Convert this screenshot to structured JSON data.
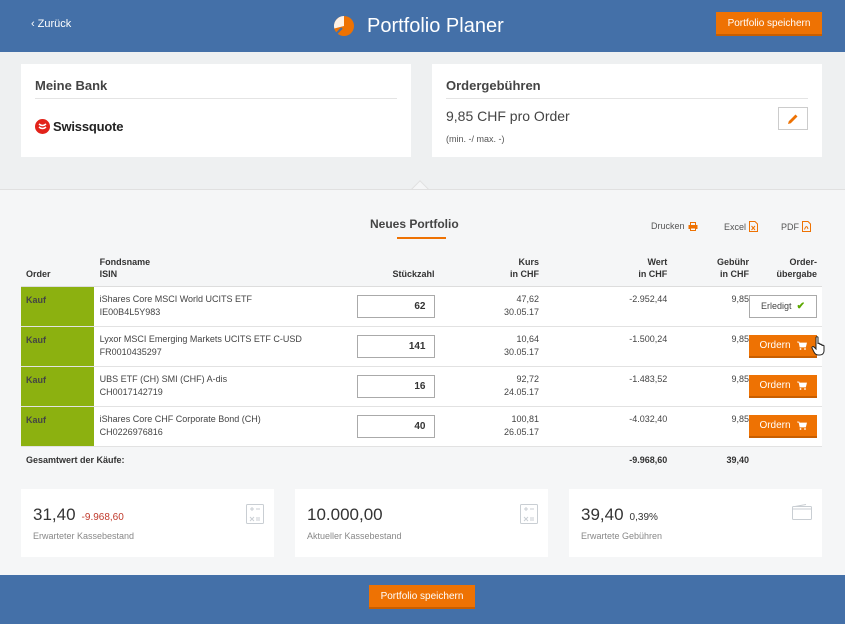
{
  "header": {
    "back_label": "Zurück",
    "title": "Portfolio Planer",
    "save_label": "Portfolio speichern",
    "logo_icon": "pie-chart-logo-icon"
  },
  "bank": {
    "heading": "Meine Bank",
    "name": "Swissquote"
  },
  "fees": {
    "heading": "Ordergebühren",
    "per_order": "9,85 CHF pro Order",
    "minmax": "(min. -/ max. -)",
    "edit_icon": "pencil-icon"
  },
  "portfolio": {
    "title": "Neues Portfolio",
    "export": {
      "print": "Drucken",
      "excel": "Excel",
      "pdf": "PDF"
    }
  },
  "table": {
    "headers": {
      "order": "Order",
      "fund_name": "Fondsname",
      "isin": "ISIN",
      "qty": "Stückzahl",
      "price_1": "Kurs",
      "price_2": "in CHF",
      "value_1": "Wert",
      "value_2": "in CHF",
      "fee_1": "Gebühr",
      "fee_2": "in CHF",
      "handover_1": "Order-",
      "handover_2": "übergabe"
    },
    "rows": [
      {
        "type": "Kauf",
        "name": "iShares Core MSCI World UCITS ETF",
        "isin": "IE00B4L5Y983",
        "qty": "62",
        "price": "47,62",
        "date": "30.05.17",
        "value": "-2.952,44",
        "fee": "9,85",
        "action": "Erledigt",
        "action_state": "done"
      },
      {
        "type": "Kauf",
        "name": "Lyxor MSCI Emerging Markets UCITS ETF C-USD",
        "isin": "FR0010435297",
        "qty": "141",
        "price": "10,64",
        "date": "30.05.17",
        "value": "-1.500,24",
        "fee": "9,85",
        "action": "Ordern",
        "action_state": "pending"
      },
      {
        "type": "Kauf",
        "name": "UBS ETF (CH) SMI (CHF) A-dis",
        "isin": "CH0017142719",
        "qty": "16",
        "price": "92,72",
        "date": "24.05.17",
        "value": "-1.483,52",
        "fee": "9,85",
        "action": "Ordern",
        "action_state": "pending"
      },
      {
        "type": "Kauf",
        "name": "iShares Core CHF Corporate Bond (CH)",
        "isin": "CH0226976816",
        "qty": "40",
        "price": "100,81",
        "date": "26.05.17",
        "value": "-4.032,40",
        "fee": "9,85",
        "action": "Ordern",
        "action_state": "pending"
      }
    ],
    "total": {
      "label": "Gesamtwert der Käufe:",
      "value": "-9.968,60",
      "fee": "39,40"
    }
  },
  "stats": [
    {
      "value": "31,40",
      "extra": "-9.968,60",
      "extra_color": "#c0392b",
      "label": "Erwarteter Kassebestand",
      "icon": "calculator-icon"
    },
    {
      "value": "10.000,00",
      "extra": "",
      "extra_color": "#333333",
      "label": "Aktueller Kassebestand",
      "icon": "calculator-icon"
    },
    {
      "value": "39,40",
      "extra": "0,39%",
      "extra_color": "#333333",
      "label": "Erwartete Gebühren",
      "icon": "wallet-icon"
    }
  ],
  "footer": {
    "save_label": "Portfolio speichern"
  },
  "colors": {
    "header_bg": "#4470a8",
    "accent": "#ee7203",
    "buy": "#8cb110",
    "negative": "#c0392b",
    "check": "#5ca800"
  }
}
